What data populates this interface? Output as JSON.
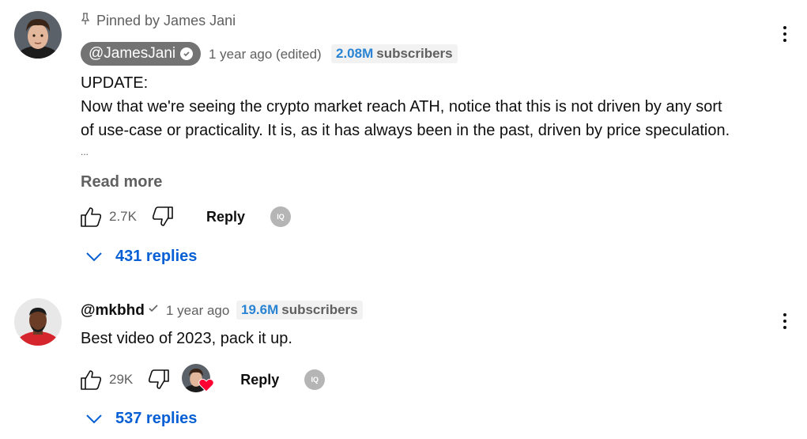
{
  "comment1": {
    "pinned_text": "Pinned by James Jani",
    "author": "@JamesJani",
    "time": "1 year ago (edited)",
    "subscribers_count": "2.08M",
    "subscribers_label": "subscribers",
    "body_line1": "UPDATE:",
    "body_line2": "Now that we're seeing the crypto market reach ATH, notice that this is not driven by any sort",
    "body_line3": "of use-case or practicality. It is, as it has always been in the past, driven by price speculation.",
    "body_line4": "...",
    "read_more": "Read more",
    "likes": "2.7K",
    "reply_label": "Reply",
    "replies_label": "431 replies"
  },
  "comment2": {
    "author": "@mkbhd",
    "time": "1 year ago",
    "subscribers_count": "19.6M",
    "subscribers_label": "subscribers",
    "body": "Best video of 2023, pack it up.",
    "likes": "29K",
    "reply_label": "Reply",
    "replies_label": "537 replies"
  },
  "icons": {
    "pin": "pin-icon",
    "like": "thumbs-up-icon",
    "dislike": "thumbs-down-icon",
    "more": "vertical-dots-icon",
    "chevron": "chevron-down-icon",
    "verified": "verified-check-icon",
    "creator_heart": "creator-heart-icon"
  },
  "colors": {
    "link_blue": "#065fd4",
    "subs_blue": "#2a84d3",
    "pill_gray": "#737373",
    "meta_gray": "#606060"
  }
}
